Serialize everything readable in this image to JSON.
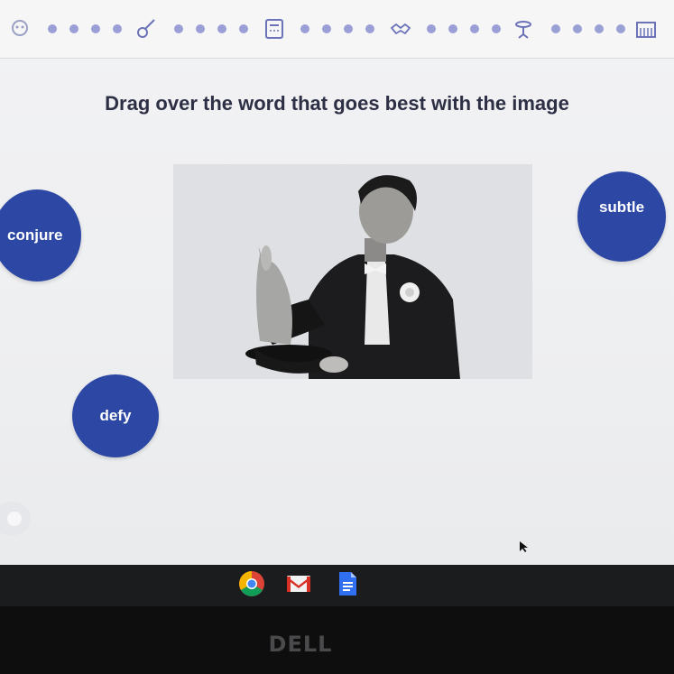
{
  "lesson": {
    "prompt": "Drag over the word that goes best with the image",
    "image_icon": "magician-with-rabbit-image"
  },
  "choices": [
    "conjure",
    "subtle",
    "defy"
  ],
  "progress": {
    "milestone_icons": [
      "head-icon",
      "guitar-icon",
      "calculator-icon",
      "handshake-icon",
      "drum-icon",
      "piano-icon"
    ],
    "dots_per_segment": 4,
    "completed_dots": 0
  },
  "taskbar": {
    "apps": [
      "chrome-icon",
      "gmail-icon",
      "docs-icon"
    ]
  },
  "hardware": {
    "brand": "DELL"
  },
  "colors": {
    "accent": "#2c47a4",
    "title": "#2d2f45"
  }
}
